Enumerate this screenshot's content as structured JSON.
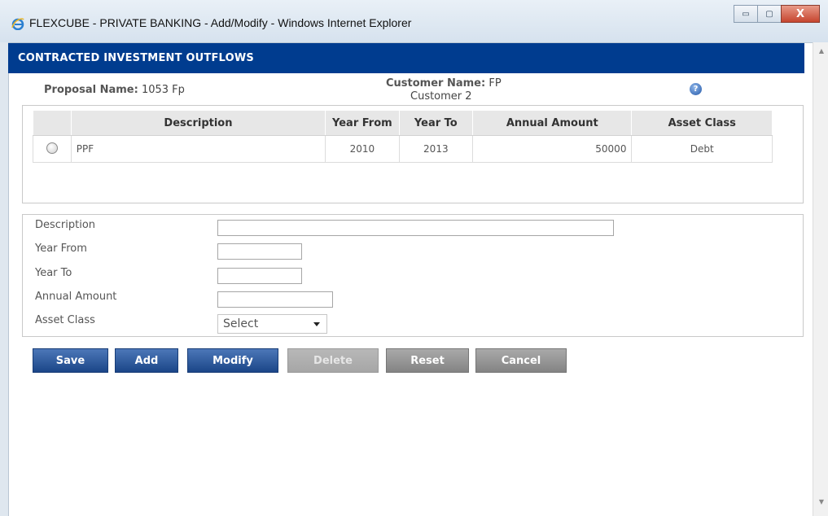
{
  "window": {
    "title": "FLEXCUBE - PRIVATE BANKING - Add/Modify - Windows Internet Explorer",
    "minimize_label": "▭",
    "maximize_label": "▢",
    "close_label": "X"
  },
  "header": {
    "title": "CONTRACTED INVESTMENT OUTFLOWS"
  },
  "proposal": {
    "label": "Proposal Name:",
    "value": "1053 Fp"
  },
  "customer": {
    "label": "Customer Name:",
    "value_line1": "FP",
    "value_line2": "Customer 2"
  },
  "help_icon": "question-circle-icon",
  "grid": {
    "columns": [
      "Description",
      "Year From",
      "Year To",
      "Annual Amount",
      "Asset Class"
    ],
    "rows": [
      {
        "description": "PPF",
        "year_from": "2010",
        "year_to": "2013",
        "annual_amount": "50000",
        "asset_class": "Debt"
      }
    ]
  },
  "form": {
    "description_label": "Description",
    "year_from_label": "Year From",
    "year_to_label": "Year To",
    "annual_amount_label": "Annual Amount",
    "asset_class_label": "Asset Class",
    "asset_class_selected": "Select",
    "description_value": "",
    "year_from_value": "",
    "year_to_value": "",
    "annual_amount_value": ""
  },
  "buttons": {
    "save": "Save",
    "add": "Add",
    "modify": "Modify",
    "delete": "Delete",
    "reset": "Reset",
    "cancel": "Cancel"
  },
  "colors": {
    "header_bar": "#003c8f",
    "primary_button": "#1b4688",
    "secondary_button": "#848484"
  }
}
